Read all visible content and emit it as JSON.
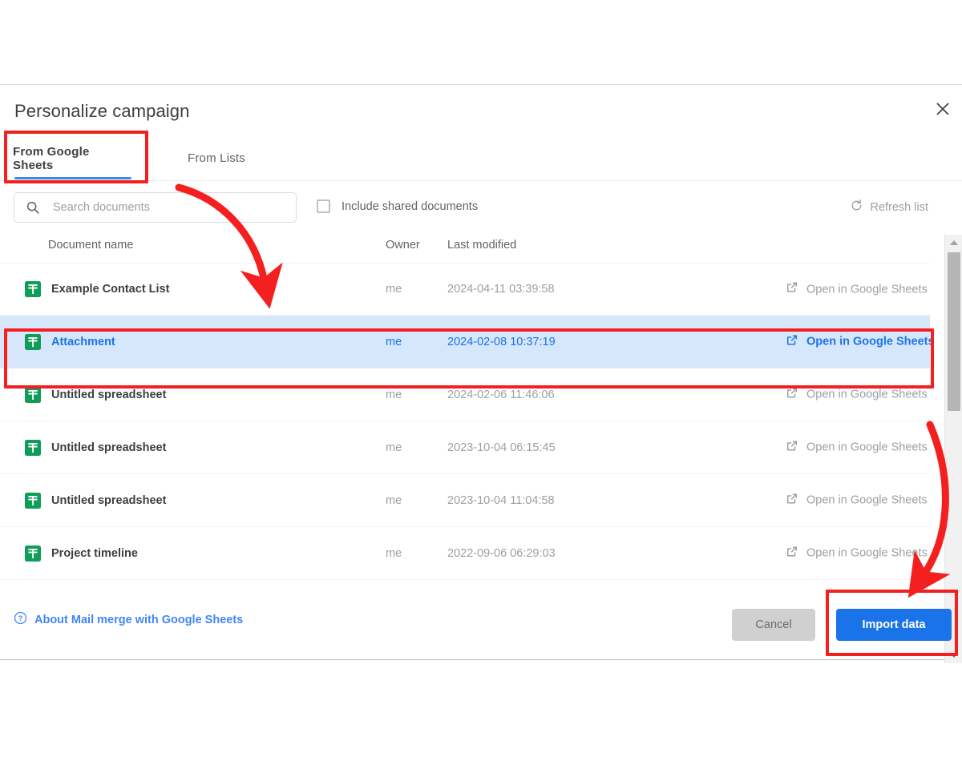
{
  "dialog": {
    "title": "Personalize campaign",
    "close_icon": "close-icon"
  },
  "tabs": [
    {
      "label": "From Google Sheets",
      "active": true
    },
    {
      "label": "From Lists",
      "active": false
    }
  ],
  "toolbar": {
    "search_placeholder": "Search documents",
    "search_value": "",
    "search_icon": "search-icon",
    "include_shared_label": "Include shared documents",
    "include_shared_checked": false,
    "refresh_label": "Refresh list",
    "refresh_icon": "refresh-icon"
  },
  "table": {
    "columns": {
      "document_name": "Document name",
      "owner": "Owner",
      "last_modified": "Last modified"
    },
    "open_link_label": "Open in Google Sheets",
    "open_link_icon": "external-link-icon",
    "file_icon": "google-sheets-icon",
    "rows": [
      {
        "name": "Example Contact List",
        "owner": "me",
        "modified": "2024-04-11 03:39:58",
        "open": "Open in Google Sheets",
        "selected": false
      },
      {
        "name": "Attachment",
        "owner": "me",
        "modified": "2024-02-08 10:37:19",
        "open": "Open in Google Sheets",
        "selected": true
      },
      {
        "name": "Untitled spreadsheet",
        "owner": "me",
        "modified": "2024-02-06 11:46:06",
        "open": "Open in Google Sheets",
        "selected": false
      },
      {
        "name": "Untitled spreadsheet",
        "owner": "me",
        "modified": "2023-10-04 06:15:45",
        "open": "Open in Google Sheets",
        "selected": false
      },
      {
        "name": "Untitled spreadsheet",
        "owner": "me",
        "modified": "2023-10-04 11:04:58",
        "open": "Open in Google Sheets",
        "selected": false
      },
      {
        "name": "Project timeline",
        "owner": "me",
        "modified": "2022-09-06 06:29:03",
        "open": "Open in Google Sheets",
        "selected": false
      }
    ]
  },
  "footer": {
    "about_label": "About Mail merge with Google Sheets",
    "about_icon": "help-circle-icon",
    "cancel_label": "Cancel",
    "import_label": "Import data"
  },
  "colors": {
    "accent_blue": "#1a73e8",
    "tab_underline": "#4285f4",
    "selected_row_bg": "#d7e7fb",
    "sheets_green": "#0f9d58",
    "annotation_red": "#f42020",
    "muted_text": "#9aa0a6"
  }
}
